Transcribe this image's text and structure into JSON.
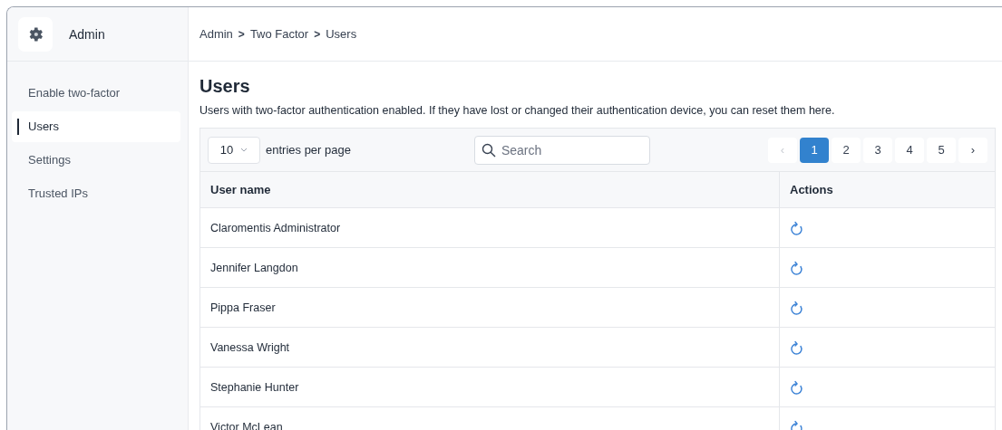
{
  "sidebar": {
    "app_name": "Admin",
    "items": [
      {
        "label": "Enable two-factor",
        "selected": false
      },
      {
        "label": "Users",
        "selected": true
      },
      {
        "label": "Settings",
        "selected": false
      },
      {
        "label": "Trusted IPs",
        "selected": false
      }
    ]
  },
  "breadcrumb": [
    "Admin",
    "Two Factor",
    "Users"
  ],
  "breadcrumb_separator": ">",
  "page": {
    "title": "Users",
    "description": "Users with two-factor authentication enabled. If they have lost or changed their authentication device, you can reset them here."
  },
  "toolbar": {
    "page_size": "10",
    "page_size_label": "entries per page",
    "search": {
      "placeholder": "Search"
    }
  },
  "pagination": {
    "prev": {
      "label": "‹",
      "disabled": true
    },
    "pages": [
      {
        "label": "1",
        "selected": true
      },
      {
        "label": "2",
        "selected": false
      },
      {
        "label": "3",
        "selected": false
      },
      {
        "label": "4",
        "selected": false
      },
      {
        "label": "5",
        "selected": false
      }
    ],
    "next": {
      "label": "›",
      "disabled": false
    }
  },
  "table": {
    "columns": [
      "User name",
      "Actions"
    ],
    "rows": [
      {
        "name": "Claromentis Administrator"
      },
      {
        "name": "Jennifer Langdon"
      },
      {
        "name": "Pippa Fraser"
      },
      {
        "name": "Vanessa Wright"
      },
      {
        "name": "Stephanie Hunter"
      },
      {
        "name": "Victor McLean"
      }
    ]
  }
}
